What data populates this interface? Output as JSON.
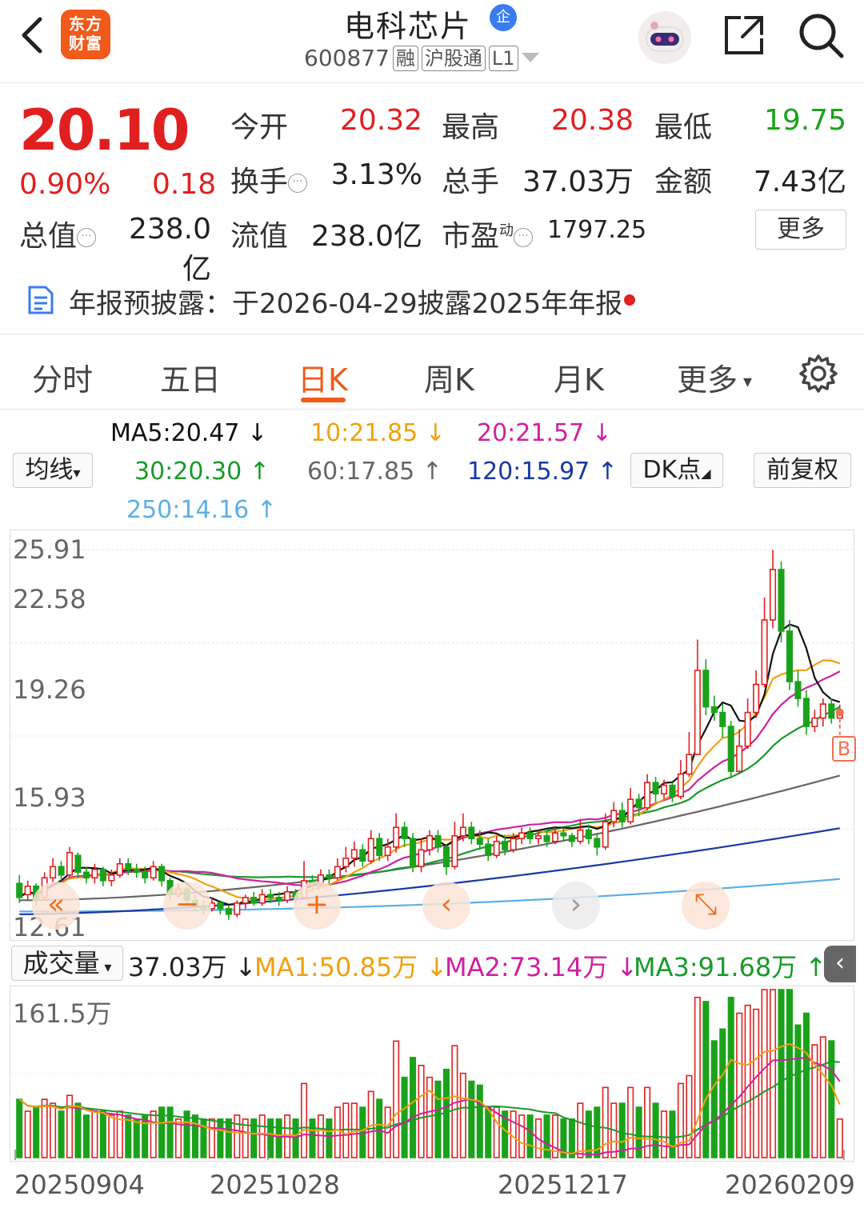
{
  "header": {
    "logo_text": "东方财富",
    "stock_name": "电科芯片",
    "qi_badge": "企",
    "stock_code": "600877",
    "tags": [
      "融",
      "沪股通",
      "L1"
    ]
  },
  "quote": {
    "price": "20.10",
    "change_pct": "0.90%",
    "change": "0.18",
    "fields": {
      "open_label": "今开",
      "open": "20.32",
      "high_label": "最高",
      "high": "20.38",
      "low_label": "最低",
      "low": "19.75",
      "turnover_label": "换手",
      "turnover": "3.13%",
      "volume_label": "总手",
      "volume": "37.03万",
      "amount_label": "金额",
      "amount": "7.43亿",
      "mktcap_label": "总值",
      "mktcap": "238.0亿",
      "float_label": "流值",
      "float": "238.0亿",
      "pe_label": "市盈",
      "pe_sup": "动",
      "pe": "1797.25"
    },
    "more_label": "更多"
  },
  "notice": {
    "text": "年报预披露：于2026-04-29披露2025年年报"
  },
  "tabs": [
    "分时",
    "五日",
    "日K",
    "周K",
    "月K",
    "更多"
  ],
  "active_tab": "日K",
  "ma_panel": {
    "selector_label": "均线",
    "ma5": "MA5:20.47",
    "ma10": "10:21.85",
    "ma20": "20:21.57",
    "ma30": "30:20.30",
    "ma60": "60:17.85",
    "ma120": "120:15.97",
    "ma250": "250:14.16",
    "dk_label": "DK点",
    "adjust_label": "前复权"
  },
  "kchart_axis": [
    "25.91",
    "22.58",
    "19.26",
    "15.93",
    "12.61"
  ],
  "signal_label": "B",
  "volume_panel": {
    "selector_label": "成交量",
    "volume": "37.03万",
    "ma1": "MA1:50.85万",
    "ma2": "MA2:73.14万",
    "ma3": "MA3:91.68万",
    "axis_max": "161.5万"
  },
  "dates": [
    "20250904",
    "20251028",
    "20251217",
    "20260209"
  ],
  "colors": {
    "up": "#e02020",
    "down": "#1aa31a",
    "accent": "#f05a1a",
    "ma5": "#111111",
    "ma10": "#f0a010",
    "ma20": "#d020a0",
    "ma30": "#1a9a2a",
    "ma60": "#666666",
    "ma120": "#1a3aa0",
    "ma250": "#5ab0e8"
  },
  "chart_data": {
    "type": "candlestick",
    "ylim": [
      12.61,
      25.91
    ],
    "x": [
      "20250904",
      "20251028",
      "20251217",
      "20260209"
    ],
    "close_last": 20.1,
    "ma_last": {
      "ma5": 20.47,
      "ma10": 21.85,
      "ma20": 21.57,
      "ma30": 20.3,
      "ma60": 17.85,
      "ma120": 15.97,
      "ma250": 14.16
    },
    "volume_ylim_max_wan": 161.5,
    "volume_last_wan": 37.03,
    "volume_ma_last_wan": {
      "ma1": 50.85,
      "ma2": 73.14,
      "ma3": 91.68
    },
    "candles": [
      [
        14.0,
        13.5,
        14.3,
        13.3
      ],
      [
        13.6,
        13.9,
        14.1,
        13.4
      ],
      [
        13.9,
        13.4,
        14.0,
        13.2
      ],
      [
        13.5,
        14.2,
        14.4,
        13.4
      ],
      [
        14.2,
        14.6,
        14.9,
        14.0
      ],
      [
        14.6,
        14.3,
        14.8,
        14.1
      ],
      [
        14.3,
        15.1,
        15.3,
        14.2
      ],
      [
        15.0,
        14.4,
        15.1,
        14.2
      ],
      [
        14.4,
        14.2,
        14.6,
        14.0
      ],
      [
        14.2,
        14.5,
        14.7,
        14.0
      ],
      [
        14.5,
        14.1,
        14.6,
        13.9
      ],
      [
        14.1,
        14.3,
        14.5,
        13.9
      ],
      [
        14.3,
        14.7,
        14.9,
        14.2
      ],
      [
        14.7,
        14.5,
        14.9,
        14.3
      ],
      [
        14.5,
        14.4,
        14.7,
        14.2
      ],
      [
        14.4,
        14.2,
        14.6,
        14.0
      ],
      [
        14.2,
        14.6,
        14.8,
        14.1
      ],
      [
        14.6,
        14.1,
        14.7,
        13.9
      ],
      [
        14.1,
        13.6,
        14.2,
        13.4
      ],
      [
        13.6,
        13.8,
        14.0,
        13.5
      ],
      [
        13.8,
        13.4,
        13.9,
        13.2
      ],
      [
        13.4,
        13.2,
        13.6,
        13.0
      ],
      [
        13.2,
        13.1,
        13.4,
        12.9
      ],
      [
        13.1,
        13.3,
        13.5,
        13.0
      ],
      [
        13.3,
        13.1,
        13.4,
        12.9
      ],
      [
        13.1,
        12.9,
        13.2,
        12.7
      ],
      [
        12.9,
        13.3,
        13.4,
        12.8
      ],
      [
        13.3,
        13.5,
        13.6,
        13.1
      ],
      [
        13.5,
        13.3,
        13.7,
        13.2
      ],
      [
        13.3,
        13.6,
        13.8,
        13.2
      ],
      [
        13.6,
        13.5,
        13.8,
        13.3
      ],
      [
        13.5,
        13.4,
        13.7,
        13.2
      ],
      [
        13.4,
        13.7,
        13.9,
        13.3
      ],
      [
        13.7,
        13.5,
        13.8,
        13.3
      ],
      [
        13.5,
        14.1,
        14.8,
        13.4
      ],
      [
        14.1,
        14.0,
        14.3,
        13.8
      ],
      [
        14.0,
        14.3,
        14.5,
        13.9
      ],
      [
        14.3,
        14.2,
        14.5,
        14.0
      ],
      [
        14.2,
        14.6,
        14.9,
        14.1
      ],
      [
        14.6,
        14.9,
        15.3,
        14.4
      ],
      [
        14.9,
        15.2,
        15.5,
        14.6
      ],
      [
        15.2,
        14.8,
        15.4,
        14.6
      ],
      [
        14.8,
        15.6,
        15.9,
        14.7
      ],
      [
        15.6,
        15.0,
        15.8,
        14.8
      ],
      [
        15.0,
        15.3,
        15.6,
        14.8
      ],
      [
        15.3,
        16.0,
        16.5,
        15.1
      ],
      [
        16.0,
        15.6,
        16.2,
        15.3
      ],
      [
        15.6,
        14.6,
        15.8,
        14.4
      ],
      [
        14.6,
        15.2,
        15.6,
        14.4
      ],
      [
        15.2,
        15.7,
        15.9,
        15.0
      ],
      [
        15.7,
        15.3,
        15.9,
        15.1
      ],
      [
        15.3,
        14.6,
        15.4,
        14.3
      ],
      [
        14.6,
        15.7,
        16.2,
        14.5
      ],
      [
        15.7,
        16.0,
        16.5,
        15.5
      ],
      [
        16.0,
        15.6,
        16.2,
        15.4
      ],
      [
        15.6,
        15.4,
        15.9,
        15.2
      ],
      [
        15.4,
        15.0,
        15.6,
        14.8
      ],
      [
        15.0,
        15.5,
        15.7,
        14.9
      ],
      [
        15.5,
        15.2,
        15.7,
        15.0
      ],
      [
        15.2,
        15.6,
        15.8,
        15.1
      ],
      [
        15.6,
        15.8,
        16.0,
        15.4
      ],
      [
        15.8,
        15.6,
        16.0,
        15.4
      ],
      [
        15.6,
        15.7,
        15.9,
        15.4
      ],
      [
        15.7,
        15.5,
        15.9,
        15.3
      ],
      [
        15.5,
        15.8,
        16.0,
        15.4
      ],
      [
        15.8,
        15.7,
        16.0,
        15.5
      ],
      [
        15.7,
        15.5,
        15.8,
        15.3
      ],
      [
        15.5,
        15.9,
        16.3,
        15.4
      ],
      [
        15.9,
        15.6,
        16.1,
        15.4
      ],
      [
        15.6,
        15.3,
        15.8,
        15.0
      ],
      [
        15.3,
        16.2,
        16.5,
        15.2
      ],
      [
        16.2,
        16.6,
        16.9,
        16.0
      ],
      [
        16.6,
        16.2,
        16.9,
        16.0
      ],
      [
        16.2,
        17.0,
        17.4,
        16.1
      ],
      [
        17.0,
        16.7,
        17.2,
        16.4
      ],
      [
        16.7,
        17.6,
        17.9,
        16.6
      ],
      [
        17.6,
        17.2,
        17.8,
        16.9
      ],
      [
        17.2,
        17.5,
        17.7,
        17.0
      ],
      [
        17.5,
        17.1,
        17.6,
        16.9
      ],
      [
        17.1,
        17.9,
        18.4,
        17.0
      ],
      [
        17.9,
        18.6,
        19.4,
        17.8
      ],
      [
        18.6,
        21.6,
        22.7,
        18.6
      ],
      [
        21.6,
        20.3,
        22.0,
        20.0
      ],
      [
        20.3,
        20.1,
        20.7,
        19.8
      ],
      [
        20.1,
        19.6,
        20.4,
        19.2
      ],
      [
        19.6,
        18.0,
        19.8,
        17.8
      ],
      [
        18.0,
        18.9,
        19.5,
        17.9
      ],
      [
        18.9,
        20.1,
        20.6,
        18.8
      ],
      [
        20.1,
        21.1,
        21.6,
        19.9
      ],
      [
        21.1,
        23.4,
        24.2,
        21.0
      ],
      [
        23.4,
        25.2,
        25.9,
        23.1
      ],
      [
        25.2,
        23.0,
        25.5,
        22.6
      ],
      [
        23.0,
        21.2,
        23.4,
        20.9
      ],
      [
        21.2,
        20.6,
        21.6,
        20.3
      ],
      [
        20.6,
        19.6,
        20.9,
        19.3
      ],
      [
        19.6,
        19.9,
        20.2,
        19.4
      ],
      [
        19.9,
        20.4,
        20.6,
        19.6
      ],
      [
        20.4,
        19.9,
        20.6,
        19.7
      ],
      [
        19.9,
        20.1,
        20.38,
        19.75
      ]
    ]
  }
}
